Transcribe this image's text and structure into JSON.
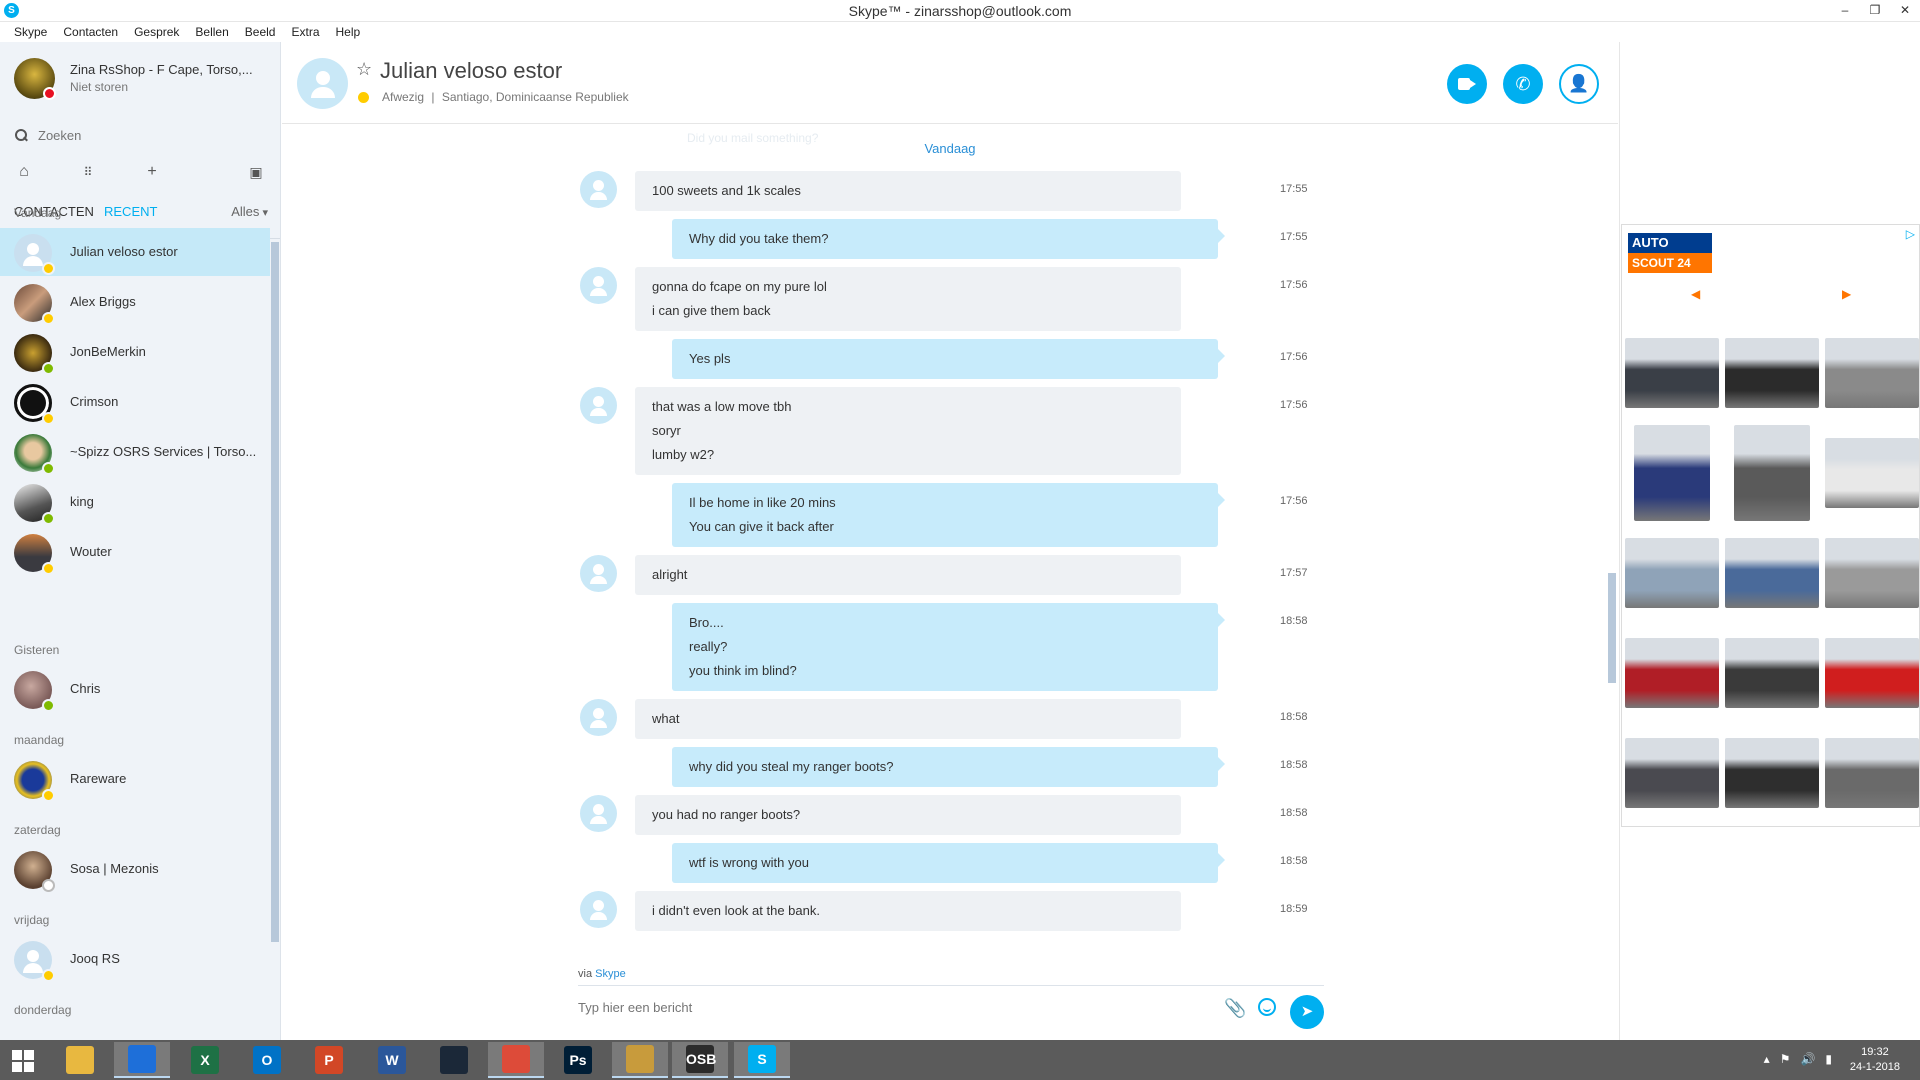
{
  "window": {
    "title": "Skype™ - zinarsshop@outlook.com",
    "app_icon_letter": "S",
    "controls": [
      "–",
      "❐",
      "✕"
    ]
  },
  "menu": [
    "Skype",
    "Contacten",
    "Gesprek",
    "Bellen",
    "Beeld",
    "Extra",
    "Help"
  ],
  "me": {
    "name": "Zina RsShop - F Cape, Torso,...",
    "status": "Niet storen"
  },
  "search": {
    "placeholder": "Zoeken"
  },
  "tabs": {
    "contacts": "CONTACTEN",
    "recent": "RECENT",
    "filter": "Alles"
  },
  "groups": {
    "today": "Vandaag",
    "yesterday": "Gisteren",
    "monday": "maandag",
    "saturday": "zaterdag",
    "friday": "vrijdag",
    "thursday": "donderdag"
  },
  "contacts": [
    {
      "name": "Julian veloso estor",
      "status": "away"
    },
    {
      "name": "Alex Briggs",
      "status": "away"
    },
    {
      "name": "JonBeMerkin",
      "status": "online"
    },
    {
      "name": "Crimson",
      "status": "away"
    },
    {
      "name": "~Spizz OSRS Services | Torso...",
      "status": "online"
    },
    {
      "name": "king",
      "status": "online"
    },
    {
      "name": "Wouter",
      "status": "away"
    },
    {
      "name": "Chris",
      "status": "online"
    },
    {
      "name": "Rareware",
      "status": "away"
    },
    {
      "name": "Sosa | Mezonis",
      "status": "offline"
    },
    {
      "name": "Jooq RS",
      "status": "away"
    }
  ],
  "conversation": {
    "name": "Julian veloso estor",
    "status": "Afwezig",
    "location": "Santiago, Dominicaanse Republiek",
    "separator": "|",
    "ghost_text": "Did you mail something?",
    "day": "Vandaag",
    "messages": [
      {
        "dir": "in",
        "lines": [
          "100 sweets and 1k scales"
        ],
        "time": "17:55"
      },
      {
        "dir": "out",
        "lines": [
          "Why did you take them?"
        ],
        "time": "17:55"
      },
      {
        "dir": "in",
        "lines": [
          "gonna do fcape on my pure lol",
          "i can give them back"
        ],
        "time": "17:56"
      },
      {
        "dir": "out",
        "lines": [
          "Yes pls"
        ],
        "time": "17:56"
      },
      {
        "dir": "in",
        "lines": [
          "that was a low move tbh",
          "soryr",
          "lumby w2?"
        ],
        "time": "17:56"
      },
      {
        "dir": "out",
        "lines": [
          "Il be home in like 20 mins",
          "You can give it back after"
        ],
        "time": "17:56"
      },
      {
        "dir": "in",
        "lines": [
          "alright"
        ],
        "time": "17:57"
      },
      {
        "dir": "out",
        "lines": [
          "Bro....",
          "really?",
          "you think im blind?"
        ],
        "time": "18:58"
      },
      {
        "dir": "in",
        "lines": [
          "what"
        ],
        "time": "18:58"
      },
      {
        "dir": "out",
        "lines": [
          "why did you steal my ranger boots?"
        ],
        "time": "18:58"
      },
      {
        "dir": "in",
        "lines": [
          "you had no ranger boots?"
        ],
        "time": "18:58"
      },
      {
        "dir": "out",
        "lines": [
          "wtf is wrong with you"
        ],
        "time": "18:58"
      },
      {
        "dir": "in",
        "lines": [
          "i didn't even look at the bank."
        ],
        "time": "18:59"
      }
    ],
    "via_prefix": "via",
    "via_link": "Skype",
    "composer_placeholder": "Typ hier een bericht"
  },
  "ad": {
    "logo_line1": "AUTO",
    "logo_line2": "SCOUT 24",
    "colors": [
      "#3a3f47",
      "#2b2b2b",
      "#8a8a8a",
      "#2a3a7a",
      "#5a5a5a",
      "#e8e8e8",
      "#8fa3b8",
      "#4a6a9a",
      "#9a9a9a",
      "#b01e26",
      "#3a3a3a",
      "#d01e1e",
      "#4a4a50",
      "#2e2e2e",
      "#6a6a6a"
    ]
  },
  "taskbar": {
    "items": [
      {
        "label": "",
        "color": "#e8b840",
        "icon": "folder-icon"
      },
      {
        "label": "",
        "color": "#1e6fd9",
        "icon": "browser-icon",
        "active": true
      },
      {
        "label": "X",
        "color": "#1e7145",
        "icon": "excel-icon"
      },
      {
        "label": "O",
        "color": "#0072c6",
        "icon": "outlook-icon"
      },
      {
        "label": "P",
        "color": "#d24726",
        "icon": "powerpoint-icon"
      },
      {
        "label": "W",
        "color": "#2b579a",
        "icon": "word-icon"
      },
      {
        "label": "",
        "color": "#1b2838",
        "icon": "steam-icon"
      },
      {
        "label": "",
        "color": "#dd4b39",
        "icon": "chrome-icon",
        "active": true
      },
      {
        "label": "Ps",
        "color": "#001e36",
        "icon": "photoshop-icon"
      },
      {
        "label": "",
        "color": "#c89b3c",
        "icon": "league-icon",
        "active": true
      },
      {
        "label": "OSB",
        "color": "#2b2b2b",
        "icon": "osbuddy-icon",
        "active": true
      },
      {
        "label": "S",
        "color": "#00aff0",
        "icon": "skype-icon",
        "active": true
      }
    ],
    "time": "19:32",
    "date": "24-1-2018"
  }
}
